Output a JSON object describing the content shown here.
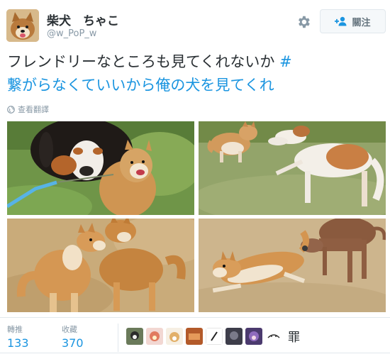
{
  "user": {
    "display_name": "柴犬　ちゃこ",
    "handle": "@w_PoP_w",
    "avatar_icon": "shiba-avatar"
  },
  "actions": {
    "settings_icon": "gear-icon",
    "follow_label": "關注",
    "follow_icon": "person-plus-icon"
  },
  "tweet": {
    "text_line1": "フレンドリーなところも見てくれないか",
    "hashtag_mark": "#",
    "hashtag_line2": "繋がらなくていいから俺の犬を見てくれ"
  },
  "translate": {
    "label": "查看翻譯",
    "icon": "globe-icon"
  },
  "photos": [
    {
      "icon": "photo-bernese-and-shiba"
    },
    {
      "icon": "photo-shiba-and-borzoi"
    },
    {
      "icon": "photo-two-shibas-playing"
    },
    {
      "icon": "photo-shiba-and-greyhound"
    }
  ],
  "stats": {
    "retweets_label": "轉推",
    "retweets_count": "133",
    "likes_label": "收藏",
    "likes_count": "370"
  },
  "likers_trailing_text": "罪",
  "colors": {
    "link_blue": "#1b95e0",
    "text_dark": "#292f33",
    "text_gray": "#8899a6",
    "border": "#e1e8ed"
  }
}
